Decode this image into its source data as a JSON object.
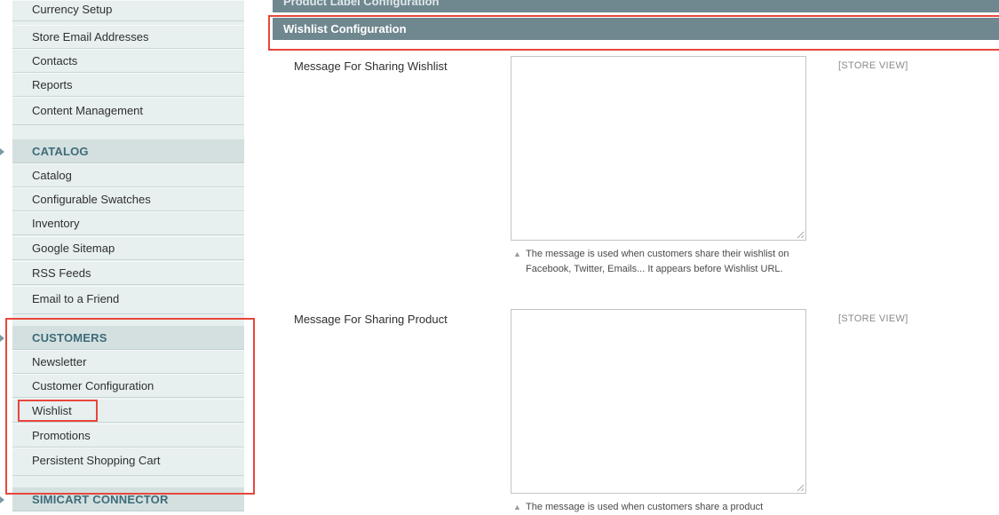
{
  "sidebar": {
    "top_items": [
      "Currency Setup",
      "Store Email Addresses",
      "Contacts",
      "Reports",
      "Content Management"
    ],
    "catalog": {
      "header": "CATALOG",
      "items": [
        "Catalog",
        "Configurable Swatches",
        "Inventory",
        "Google Sitemap",
        "RSS Feeds",
        "Email to a Friend"
      ]
    },
    "customers": {
      "header": "CUSTOMERS",
      "items": [
        "Newsletter",
        "Customer Configuration",
        "Wishlist",
        "Promotions",
        "Persistent Shopping Cart"
      ]
    },
    "simicart": {
      "header": "SIMICART CONNECTOR"
    }
  },
  "main": {
    "prev_section_title": "Product Label Configuration",
    "section_title": "Wishlist Configuration",
    "fields": [
      {
        "label": "Message For Sharing Wishlist",
        "value": "",
        "scope": "[STORE VIEW]",
        "note": "The message is used when customers share their wishlist on Facebook, Twitter, Emails... It appears before Wishlist URL."
      },
      {
        "label": "Message For Sharing Product",
        "value": "",
        "scope": "[STORE VIEW]",
        "note": "The message is used when customers share a product"
      }
    ]
  },
  "colors": {
    "highlight": "#e8463c",
    "section_header": "#6f878f",
    "sidebar_bg": "#e7efef",
    "sidebar_header_text": "#3d6b78"
  }
}
